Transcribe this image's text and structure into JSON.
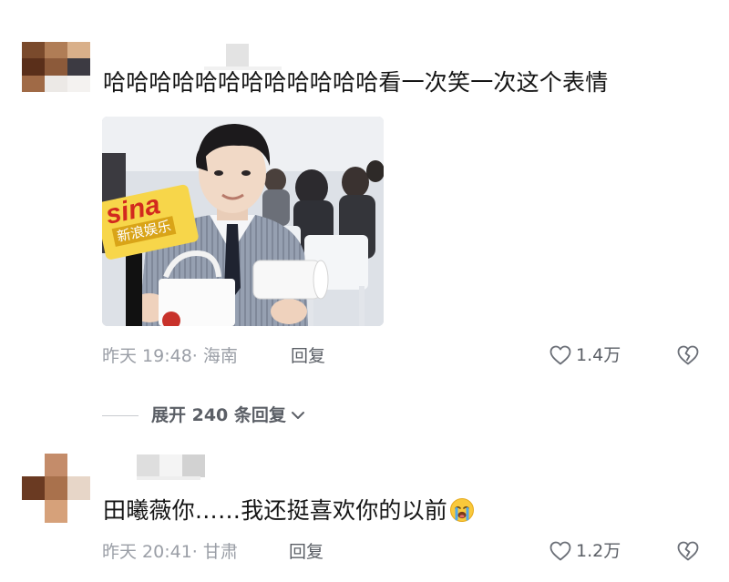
{
  "comments": [
    {
      "text": "哈哈哈哈哈哈哈哈哈哈哈哈看一次笑一次这个表情",
      "image": {
        "sticker_brand": "sina",
        "sticker_caption": "新浪娱乐"
      },
      "time": "昨天 19:48",
      "location": "· 海南",
      "reply_label": "回复",
      "likes": "1.4万",
      "avatar_colors": [
        "#7a4a2c",
        "#b07d56",
        "#d9b08a",
        "#5a2f1a",
        "#8c5a3a",
        "#3c3a42",
        "#a06a46",
        "#d8d4d0",
        "#ece9e6"
      ]
    },
    {
      "text": "田曦薇你……我还挺喜欢你的以前",
      "time": "昨天 20:41",
      "location": "· 甘肃",
      "reply_label": "回复",
      "likes": "1.2万",
      "avatar_colors": [
        "#ffffff",
        "#c48c6a",
        "#ffffff",
        "#6a3a22",
        "#a9714c",
        "#e7d6c8",
        "#ffffff",
        "#d6a17a",
        "#ffffff"
      ]
    }
  ],
  "expand_replies": {
    "label": "展开 240 条回复"
  },
  "icons": {
    "like": "heart-outline-icon",
    "dislike": "broken-heart-icon",
    "expand": "chevron-down-icon",
    "emoji": "crying-face-emoji"
  }
}
